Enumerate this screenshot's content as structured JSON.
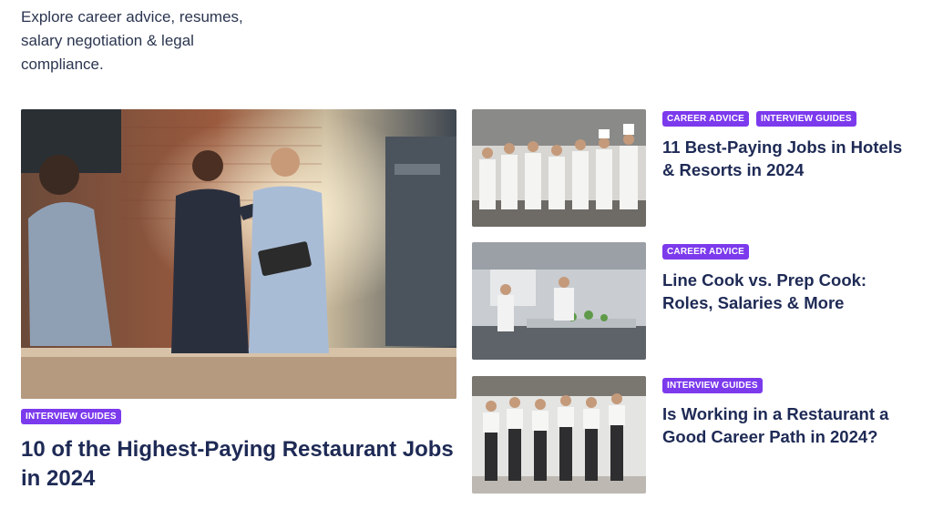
{
  "intro": {
    "text": "Explore career advice, resumes, salary negotiation & legal compliance."
  },
  "hero": {
    "tag": "INTERVIEW GUIDES",
    "title": "10 of the Highest-Paying Restaurant Jobs in 2024",
    "image_alt": "Restaurant manager pointing with colleague holding tablet"
  },
  "cards": [
    {
      "tags": [
        "CAREER ADVICE",
        "INTERVIEW GUIDES"
      ],
      "title": "11 Best-Paying Jobs in Hotels & Resorts in 2024",
      "image_alt": "Hotel and kitchen staff group"
    },
    {
      "tags": [
        "CAREER ADVICE"
      ],
      "title": "Line Cook vs. Prep Cook: Roles, Salaries & More",
      "image_alt": "Commercial kitchen with cooks"
    },
    {
      "tags": [
        "INTERVIEW GUIDES"
      ],
      "title": "Is Working in a Restaurant a Good Career Path in 2024?",
      "image_alt": "Restaurant team standing together"
    }
  ],
  "colors": {
    "badge": "#7c3aed",
    "title": "#1e2a55",
    "body_text": "#2b3550"
  }
}
